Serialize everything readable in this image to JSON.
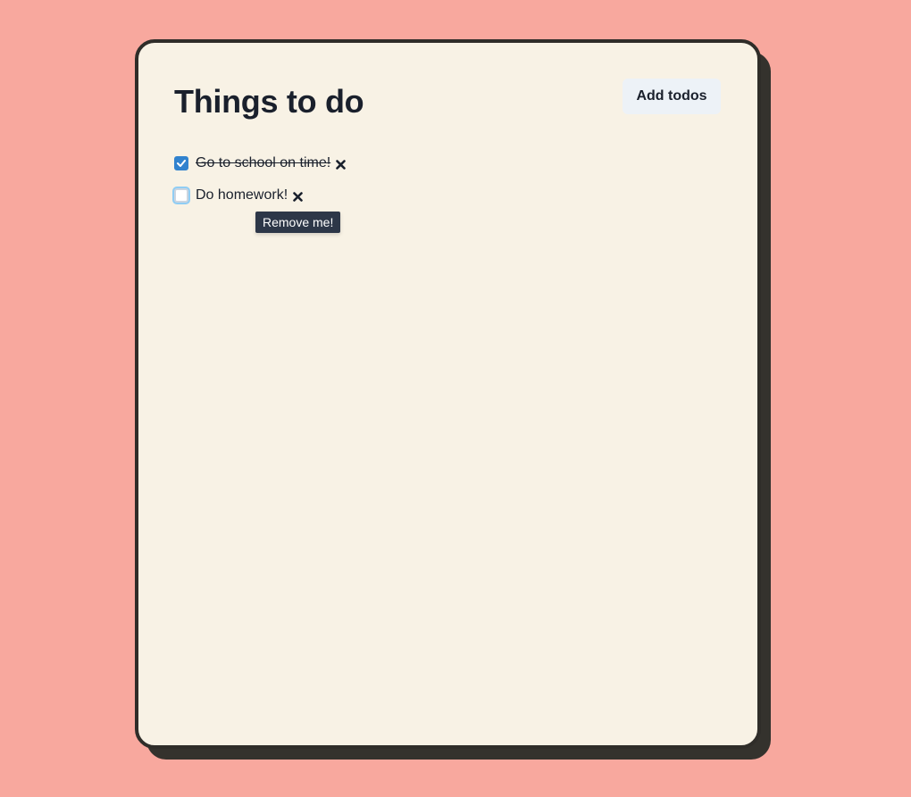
{
  "header": {
    "title": "Things to do",
    "add_button_label": "Add todos"
  },
  "todos": [
    {
      "text": "Go to school on time!",
      "checked": true,
      "remove_icon": "close-icon"
    },
    {
      "text": "Do homework!",
      "checked": false,
      "remove_icon": "close-icon"
    }
  ],
  "tooltip": {
    "text": "Remove me!"
  },
  "colors": {
    "page_background": "#f8a89e",
    "card_background": "#f8f2e5",
    "card_border": "#2f2d29",
    "checkbox_accent": "#3182ce",
    "tooltip_background": "#2d3748"
  }
}
